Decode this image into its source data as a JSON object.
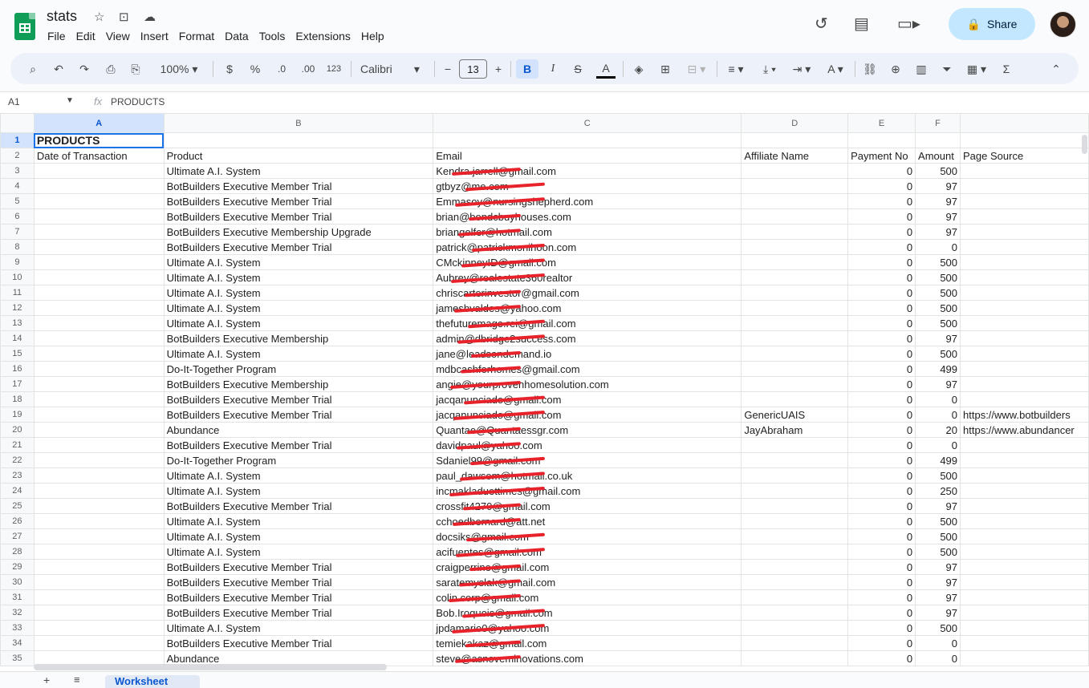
{
  "app": {
    "doc_title": "stats",
    "menu": [
      "File",
      "Edit",
      "View",
      "Insert",
      "Format",
      "Data",
      "Tools",
      "Extensions",
      "Help"
    ],
    "share_label": "Share"
  },
  "toolbar": {
    "zoom": "100%",
    "currency": "$",
    "percent": "%",
    "dec_decrease": ".0",
    "dec_increase": ".00",
    "format_123": "123",
    "font": "Calibri",
    "font_size": "13"
  },
  "formula_bar": {
    "cell_ref": "A1",
    "fx": "fx",
    "content": "PRODUCTS"
  },
  "columns": [
    "A",
    "B",
    "C",
    "D",
    "E",
    "F",
    ""
  ],
  "rows": [
    {
      "n": "1",
      "a": "PRODUCTS",
      "b": "",
      "c": "",
      "d": "",
      "e": "",
      "f": "",
      "g": ""
    },
    {
      "n": "2",
      "a": "Date of Transaction",
      "b": "Product",
      "c": "Email",
      "d": "Affiliate Name",
      "e": "Payment No",
      "f": "Amount",
      "g": "Page Source"
    },
    {
      "n": "3",
      "a": "",
      "b": "Ultimate A.I. System",
      "c": "Kendra.jarrell@gmail.com",
      "d": "",
      "e": "0",
      "f": "500",
      "g": ""
    },
    {
      "n": "4",
      "a": "",
      "b": "BotBuilders Executive Member Trial",
      "c": "gtbyz@me.com",
      "d": "",
      "e": "0",
      "f": "97",
      "g": ""
    },
    {
      "n": "5",
      "a": "",
      "b": "BotBuilders Executive Member Trial",
      "c": "Emmasoy@nursingshepherd.com",
      "d": "",
      "e": "0",
      "f": "97",
      "g": ""
    },
    {
      "n": "6",
      "a": "",
      "b": "BotBuilders Executive Member Trial",
      "c": "brian@bondcbuyhouses.com",
      "d": "",
      "e": "0",
      "f": "97",
      "g": ""
    },
    {
      "n": "7",
      "a": "",
      "b": "BotBuilders Executive Membership Upgrade",
      "c": "briangelfer@hotmail.com",
      "d": "",
      "e": "0",
      "f": "97",
      "g": ""
    },
    {
      "n": "8",
      "a": "",
      "b": "BotBuilders Executive Member Trial",
      "c": "patrick@patrickmonihoon.com",
      "d": "",
      "e": "0",
      "f": "0",
      "g": ""
    },
    {
      "n": "9",
      "a": "",
      "b": "Ultimate A.I. System",
      "c": "CMckinneyID@gmail.com",
      "d": "",
      "e": "0",
      "f": "500",
      "g": ""
    },
    {
      "n": "10",
      "a": "",
      "b": "Ultimate A.I. System",
      "c": "Aubrey@realestate360realtor",
      "d": "",
      "e": "0",
      "f": "500",
      "g": ""
    },
    {
      "n": "11",
      "a": "",
      "b": "Ultimate A.I. System",
      "c": "chriscarterinvestor@gmail.com",
      "d": "",
      "e": "0",
      "f": "500",
      "g": ""
    },
    {
      "n": "12",
      "a": "",
      "b": "Ultimate A.I. System",
      "c": "jamesbvaldes@yahoo.com",
      "d": "",
      "e": "0",
      "f": "500",
      "g": ""
    },
    {
      "n": "13",
      "a": "",
      "b": "Ultimate A.I. System",
      "c": "thefuturemage.rei@gmail.com",
      "d": "",
      "e": "0",
      "f": "500",
      "g": ""
    },
    {
      "n": "14",
      "a": "",
      "b": "BotBuilders Executive Membership",
      "c": "admin@dbridge2success.com",
      "d": "",
      "e": "0",
      "f": "97",
      "g": ""
    },
    {
      "n": "15",
      "a": "",
      "b": "Ultimate A.I. System",
      "c": "jane@leadsondemand.io",
      "d": "",
      "e": "0",
      "f": "500",
      "g": ""
    },
    {
      "n": "16",
      "a": "",
      "b": "Do-It-Together Program",
      "c": "mdbcashforhomes@gmail.com",
      "d": "",
      "e": "0",
      "f": "499",
      "g": ""
    },
    {
      "n": "17",
      "a": "",
      "b": "BotBuilders Executive Membership",
      "c": "angie@yourprovenhomesolution.com",
      "d": "",
      "e": "0",
      "f": "97",
      "g": ""
    },
    {
      "n": "18",
      "a": "",
      "b": "BotBuilders Executive Member Trial",
      "c": "jacqanunciado@gmail.com",
      "d": "",
      "e": "0",
      "f": "0",
      "g": ""
    },
    {
      "n": "19",
      "a": "",
      "b": "BotBuilders Executive Member Trial",
      "c": "jacqanunciado@gmail.com",
      "d": "GenericUAIS",
      "e": "0",
      "f": "0",
      "g": "https://www.botbuilders"
    },
    {
      "n": "20",
      "a": "",
      "b": "Abundance",
      "c": "Quantae@Quantaessgr.com",
      "d": "JayAbraham",
      "e": "0",
      "f": "20",
      "g": "https://www.abundancer"
    },
    {
      "n": "21",
      "a": "",
      "b": "BotBuilders Executive Member Trial",
      "c": "davidpaul@yahoo.com",
      "d": "",
      "e": "0",
      "f": "0",
      "g": ""
    },
    {
      "n": "22",
      "a": "",
      "b": "Do-It-Together Program",
      "c": "Sdaniel99@gmail.com",
      "d": "",
      "e": "0",
      "f": "499",
      "g": ""
    },
    {
      "n": "23",
      "a": "",
      "b": "Ultimate A.I. System",
      "c": "paul_dawsom@hotmail.co.uk",
      "d": "",
      "e": "0",
      "f": "500",
      "g": ""
    },
    {
      "n": "24",
      "a": "",
      "b": "Ultimate A.I. System",
      "c": "incmakladuettimes@gmail.com",
      "d": "",
      "e": "0",
      "f": "250",
      "g": ""
    },
    {
      "n": "25",
      "a": "",
      "b": "BotBuilders Executive Member Trial",
      "c": "crossfit4270@gmail.com",
      "d": "",
      "e": "0",
      "f": "97",
      "g": ""
    },
    {
      "n": "26",
      "a": "",
      "b": "Ultimate A.I. System",
      "c": "cchoedbernard@att.net",
      "d": "",
      "e": "0",
      "f": "500",
      "g": ""
    },
    {
      "n": "27",
      "a": "",
      "b": "Ultimate A.I. System",
      "c": "docsiks@gmail.com",
      "d": "",
      "e": "0",
      "f": "500",
      "g": ""
    },
    {
      "n": "28",
      "a": "",
      "b": "Ultimate A.I. System",
      "c": "acifuentes@gmail.com",
      "d": "",
      "e": "0",
      "f": "500",
      "g": ""
    },
    {
      "n": "29",
      "a": "",
      "b": "BotBuilders Executive Member Trial",
      "c": "craigperrine@gmail.com",
      "d": "",
      "e": "0",
      "f": "97",
      "g": ""
    },
    {
      "n": "30",
      "a": "",
      "b": "BotBuilders Executive Member Trial",
      "c": "saratemyslak@gmail.com",
      "d": "",
      "e": "0",
      "f": "97",
      "g": ""
    },
    {
      "n": "31",
      "a": "",
      "b": "BotBuilders Executive Member Trial",
      "c": "colin.corp@gmail.com",
      "d": "",
      "e": "0",
      "f": "97",
      "g": ""
    },
    {
      "n": "32",
      "a": "",
      "b": "BotBuilders Executive Member Trial",
      "c": "Bob.Iroquois@gmail.com",
      "d": "",
      "e": "0",
      "f": "97",
      "g": ""
    },
    {
      "n": "33",
      "a": "",
      "b": "Ultimate A.I. System",
      "c": "jpdamario0@yahoo.com",
      "d": "",
      "e": "0",
      "f": "500",
      "g": ""
    },
    {
      "n": "34",
      "a": "",
      "b": "BotBuilders Executive Member Trial",
      "c": "temiekakaz@gmail.com",
      "d": "",
      "e": "0",
      "f": "0",
      "g": ""
    },
    {
      "n": "35",
      "a": "",
      "b": "Abundance",
      "c": "steve@asnoveminovations.com",
      "d": "",
      "e": "0",
      "f": "0",
      "g": ""
    }
  ],
  "bottom": {
    "sheet_tab": "Worksheet"
  },
  "colors": {
    "accent": "#1a73e8",
    "share_bg": "#c2e7ff",
    "sheets_green": "#0f9d58",
    "redaction": "#e8222a"
  }
}
